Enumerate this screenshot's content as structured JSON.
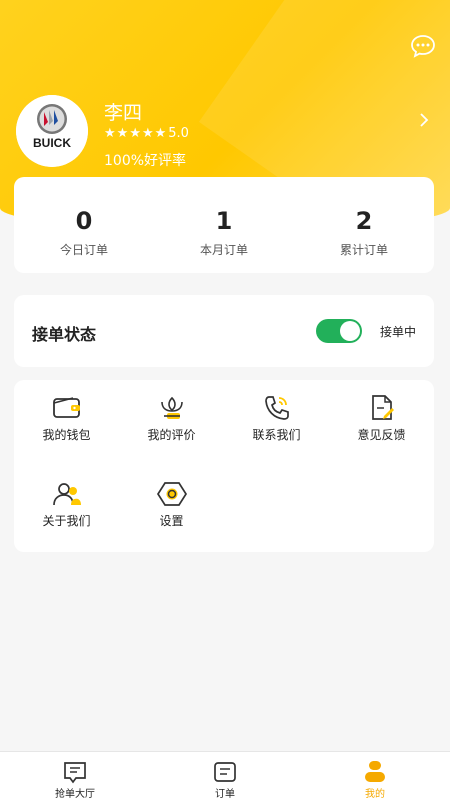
{
  "profile": {
    "name": "李四",
    "rating": "5.0",
    "praise": "100%好评率",
    "avatar_brand": "BUICK"
  },
  "stats": [
    {
      "value": "0",
      "label": "今日订单"
    },
    {
      "value": "1",
      "label": "本月订单"
    },
    {
      "value": "2",
      "label": "累计订单"
    }
  ],
  "order_status": {
    "title": "接单状态",
    "toggle_on": true,
    "state_text": "接单中"
  },
  "menu": [
    {
      "label": "我的钱包",
      "icon": "wallet-icon"
    },
    {
      "label": "我的评价",
      "icon": "review-icon"
    },
    {
      "label": "联系我们",
      "icon": "phone-icon"
    },
    {
      "label": "意见反馈",
      "icon": "feedback-icon"
    },
    {
      "label": "关于我们",
      "icon": "people-icon"
    },
    {
      "label": "设置",
      "icon": "settings-icon"
    }
  ],
  "bottom_nav": [
    {
      "label": "抢单大厅",
      "icon": "hall-icon",
      "active": false
    },
    {
      "label": "订单",
      "icon": "order-icon",
      "active": false
    },
    {
      "label": "我的",
      "icon": "profile-icon",
      "active": true
    }
  ],
  "colors": {
    "brand_yellow": "#ffc800",
    "accent_orange": "#f5a900",
    "toggle_green": "#22b05a"
  }
}
